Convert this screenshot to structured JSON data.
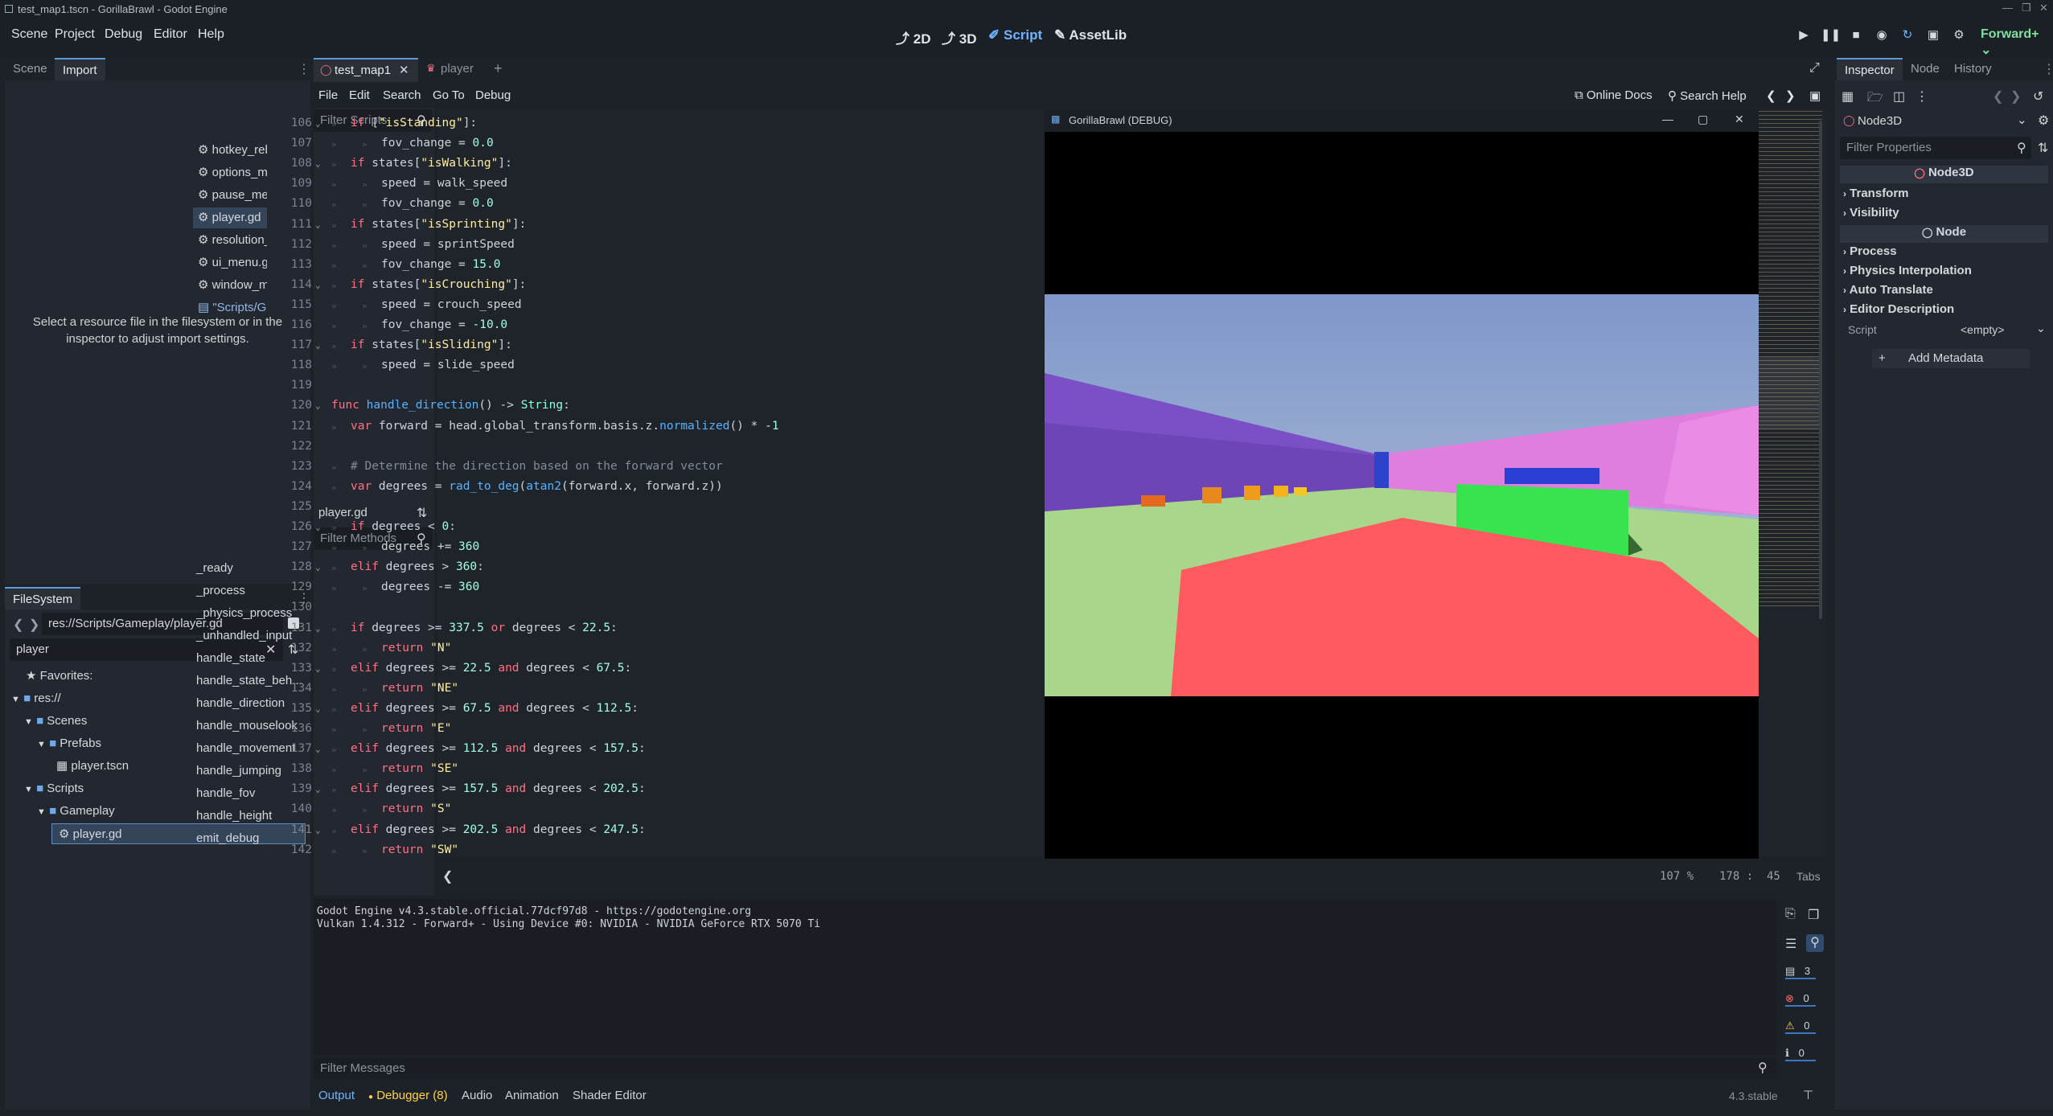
{
  "window": {
    "title": "test_map1.tscn - GorillaBrawl - Godot Engine"
  },
  "menu": {
    "items": [
      "Scene",
      "Project",
      "Debug",
      "Editor",
      "Help"
    ]
  },
  "modes": {
    "m2d": "2D",
    "m3d": "3D",
    "script": "Script",
    "assetlib": "AssetLib"
  },
  "renderer": "Forward+",
  "left_dock": {
    "tabs": [
      "Scene",
      "Import"
    ],
    "import_msg": "Select a resource file in the filesystem or in the inspector to adjust import settings."
  },
  "filesystem": {
    "title": "FileSystem",
    "path": "res://Scripts/Gameplay/player.gd",
    "search": "player",
    "tree": [
      "Favorites:",
      "res://",
      "Scenes",
      "Prefabs",
      "player.tscn",
      "Scripts",
      "Gameplay",
      "player.gd"
    ]
  },
  "editor_tabs": {
    "t1": "test_map1",
    "t2": "player"
  },
  "script_menu": [
    "File",
    "Edit",
    "Search",
    "Go To",
    "Debug"
  ],
  "script_links": {
    "docs": "Online Docs",
    "help": "Search Help"
  },
  "scripts": {
    "filter_placeholder": "Filter Scripts",
    "items": [
      "hotkey_rebind...",
      "options_menu...",
      "pause_menu.gd",
      "player.gd",
      "resolution_mo...",
      "ui_menu.gd",
      "window_mode...",
      "\"Scripts/Game..."
    ],
    "current": "player.gd",
    "methods_placeholder": "Filter Methods",
    "methods": [
      "_ready",
      "_process",
      "_physics_process",
      "_unhandled_input",
      "handle_state",
      "handle_state_beh...",
      "handle_direction",
      "handle_mouselook",
      "handle_movement",
      "handle_jumping",
      "handle_fov",
      "handle_height",
      "emit_debug"
    ]
  },
  "code": {
    "lines": [
      {
        "n": "106",
        "html": "<span class='kw'>if</span> [<span class='str'>\"isStanding\"</span>]:",
        "indent": 1,
        "fold": true
      },
      {
        "n": "107",
        "html": "fov_change = <span class='num'>0.0</span>",
        "indent": 2
      },
      {
        "n": "108",
        "html": "<span class='kw'>if</span> states[<span class='str'>\"isWalking\"</span>]:",
        "indent": 1,
        "fold": true
      },
      {
        "n": "109",
        "html": "speed = walk_speed",
        "indent": 2
      },
      {
        "n": "110",
        "html": "fov_change = <span class='num'>0.0</span>",
        "indent": 2
      },
      {
        "n": "111",
        "html": "<span class='kw'>if</span> states[<span class='str'>\"isSprinting\"</span>]:",
        "indent": 1,
        "fold": true
      },
      {
        "n": "112",
        "html": "speed = sprintSpeed",
        "indent": 2
      },
      {
        "n": "113",
        "html": "fov_change = <span class='num'>15.0</span>",
        "indent": 2
      },
      {
        "n": "114",
        "html": "<span class='kw'>if</span> states[<span class='str'>\"isCrouching\"</span>]:",
        "indent": 1,
        "fold": true
      },
      {
        "n": "115",
        "html": "speed = crouch_speed",
        "indent": 2
      },
      {
        "n": "116",
        "html": "fov_change = <span class='num'>-10.0</span>",
        "indent": 2
      },
      {
        "n": "117",
        "html": "<span class='kw'>if</span> states[<span class='str'>\"isSliding\"</span>]:",
        "indent": 1,
        "fold": true
      },
      {
        "n": "118",
        "html": "speed = slide_speed",
        "indent": 2
      },
      {
        "n": "119",
        "html": "",
        "indent": 0
      },
      {
        "n": "120",
        "html": "<span class='kw'>func</span> <span class='fn'>handle_direction</span>() -&gt; <span class='ty'>String</span>:",
        "indent": 0,
        "fold": true
      },
      {
        "n": "121",
        "html": "<span class='kw'>var</span> forward = head.global_transform.basis.z.<span class='fn'>normalized</span>() * <span class='num'>-1</span>",
        "indent": 1
      },
      {
        "n": "122",
        "html": "",
        "indent": 0
      },
      {
        "n": "123",
        "html": "<span class='cm'># Determine the direction based on the forward vector</span>",
        "indent": 1
      },
      {
        "n": "124",
        "html": "<span class='kw'>var</span> degrees = <span class='fn'>rad_to_deg</span>(<span class='fn'>atan2</span>(forward.x, forward.z))",
        "indent": 1
      },
      {
        "n": "125",
        "html": "",
        "indent": 0
      },
      {
        "n": "126",
        "html": "<span class='kw'>if</span> degrees &lt; <span class='num'>0</span>:",
        "indent": 1,
        "fold": true
      },
      {
        "n": "127",
        "html": "degrees += <span class='num'>360</span>",
        "indent": 2
      },
      {
        "n": "128",
        "html": "<span class='kw'>elif</span> degrees &gt; <span class='num'>360</span>:",
        "indent": 1,
        "fold": true
      },
      {
        "n": "129",
        "html": "degrees -= <span class='num'>360</span>",
        "indent": 2
      },
      {
        "n": "130",
        "html": "",
        "indent": 0
      },
      {
        "n": "131",
        "html": "<span class='kw'>if</span> degrees &gt;= <span class='num'>337.5</span> <span class='kw'>or</span> degrees &lt; <span class='num'>22.5</span>:",
        "indent": 1,
        "fold": true
      },
      {
        "n": "132",
        "html": "<span class='kw'>return</span> <span class='str'>\"N\"</span>",
        "indent": 2
      },
      {
        "n": "133",
        "html": "<span class='kw'>elif</span> degrees &gt;= <span class='num'>22.5</span> <span class='kw'>and</span> degrees &lt; <span class='num'>67.5</span>:",
        "indent": 1,
        "fold": true
      },
      {
        "n": "134",
        "html": "<span class='kw'>return</span> <span class='str'>\"NE\"</span>",
        "indent": 2
      },
      {
        "n": "135",
        "html": "<span class='kw'>elif</span> degrees &gt;= <span class='num'>67.5</span> <span class='kw'>and</span> degrees &lt; <span class='num'>112.5</span>:",
        "indent": 1,
        "fold": true
      },
      {
        "n": "136",
        "html": "<span class='kw'>return</span> <span class='str'>\"E\"</span>",
        "indent": 2
      },
      {
        "n": "137",
        "html": "<span class='kw'>elif</span> degrees &gt;= <span class='num'>112.5</span> <span class='kw'>and</span> degrees &lt; <span class='num'>157.5</span>:",
        "indent": 1,
        "fold": true
      },
      {
        "n": "138",
        "html": "<span class='kw'>return</span> <span class='str'>\"SE\"</span>",
        "indent": 2
      },
      {
        "n": "139",
        "html": "<span class='kw'>elif</span> degrees &gt;= <span class='num'>157.5</span> <span class='kw'>and</span> degrees &lt; <span class='num'>202.5</span>:",
        "indent": 1,
        "fold": true
      },
      {
        "n": "140",
        "html": "<span class='kw'>return</span> <span class='str'>\"S\"</span>",
        "indent": 2
      },
      {
        "n": "141",
        "html": "<span class='kw'>elif</span> degrees &gt;= <span class='num'>202.5</span> <span class='kw'>and</span> degrees &lt; <span class='num'>247.5</span>:",
        "indent": 1,
        "fold": true
      },
      {
        "n": "142",
        "html": "<span class='kw'>return</span> <span class='str'>\"SW\"</span>",
        "indent": 2
      }
    ],
    "zoom": "107 %",
    "cursor": "178 :  45",
    "indent_mode": "Tabs"
  },
  "game_window": {
    "title": "GorillaBrawl (DEBUG)"
  },
  "output": {
    "lines": [
      "Godot Engine v4.3.stable.official.77dcf97d8 - https://godotengine.org",
      "Vulkan 1.4.312 - Forward+ - Using Device #0: NVIDIA - NVIDIA GeForce RTX 5070 Ti"
    ],
    "filter_placeholder": "Filter Messages",
    "counts": [
      "3",
      "0",
      "0",
      "0"
    ]
  },
  "bottom_tabs": [
    "Output",
    "Debugger (8)",
    "Audio",
    "Animation",
    "Shader Editor"
  ],
  "version": "4.3.stable",
  "inspector": {
    "tabs": [
      "Inspector",
      "Node",
      "History"
    ],
    "node": "Node3D",
    "filter_placeholder": "Filter Properties",
    "class1": "Node3D",
    "sections1": [
      "Transform",
      "Visibility"
    ],
    "class2": "Node",
    "sections2": [
      "Process",
      "Physics Interpolation",
      "Auto Translate",
      "Editor Description"
    ],
    "script_label": "Script",
    "script_value": "<empty>",
    "add_metadata": "Add Metadata"
  }
}
